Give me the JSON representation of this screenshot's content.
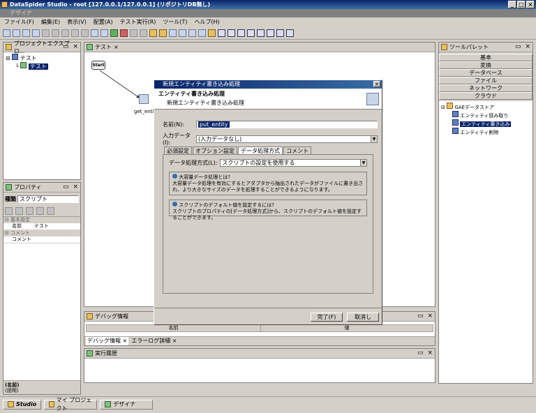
{
  "window": {
    "title": "DataSpider Studio - root [127.0.0.1/127.0.0.1] (リポジトリDB無し)",
    "subtitle": "デザイナ"
  },
  "menu": [
    "ファイル(F)",
    "編集(E)",
    "表示(V)",
    "配置(A)",
    "テスト実行(R)",
    "ツール(T)",
    "ヘルプ(H)"
  ],
  "project_explorer": {
    "title": "プロジェクトエクスプロ...",
    "root": "テスト",
    "child": "テスト"
  },
  "canvas": {
    "tab": "テスト",
    "start_label": "Start",
    "node_label": "get_entity"
  },
  "properties": {
    "title": "プロパティ",
    "type_label": "種類",
    "type_value": "スクリプト",
    "section_basic": "基本設定",
    "name_key": "名前",
    "name_value": "テスト",
    "section_comment": "コメント",
    "comment_key": "コメント",
    "footer_name": "(名前)",
    "footer_desc": "(説明)"
  },
  "tool_palette": {
    "title": "ツールパレット",
    "categories": [
      "基本",
      "変換",
      "データベース",
      "ファイル",
      "ネットワーク",
      "クラウド"
    ],
    "tree_root": "GAEデータストア",
    "items": [
      "エンティティ読み取り",
      "エンティティ書き込み",
      "エンティティ削除"
    ]
  },
  "debug": {
    "title": "デバッグ情報",
    "col_name": "名前",
    "col_value": "値",
    "tab1": "デバッグ情報",
    "tab2": "エラーログ詳細"
  },
  "history": {
    "title": "実行履歴"
  },
  "dialog": {
    "title": "新規エンティティ書き込み処理",
    "header_title": "エンティティ書き込み処理",
    "header_sub": "新規エンティティ書き込み処理",
    "name_label": "名前(N):",
    "name_value": "put_entity",
    "input_label": "入力データ(I):",
    "input_value": "(入力データなし)",
    "tabs": [
      "必須設定",
      "オプション設定",
      "データ処理方式",
      "コメント"
    ],
    "method_label": "データ処理方式(L):",
    "method_value": "スクリプトの設定を使用する",
    "info1_title": "大容量データ処理とは?",
    "info1_text": "大容量データ処理を有効にするとアダプタから抽出されたデータがファイルに書き出され、より大きなサイズのデータを処理することができるようになります。",
    "info2_title": "スクリプトのデフォルト値を設定するには?",
    "info2_text": "スクリプトのプロパティの[データ処理方式]から、スクリプトのデフォルト値を設定することができます。",
    "ok": "完了(F)",
    "cancel": "取消し"
  },
  "bottom": {
    "studio": "Studio",
    "project": "マイ プロジェクト",
    "designer": "デザイナ"
  }
}
